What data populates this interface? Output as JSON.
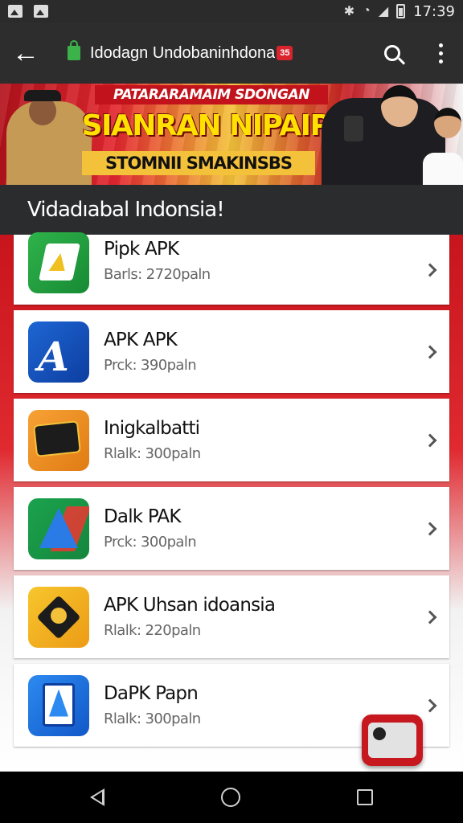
{
  "status_bar": {
    "time": "17:39",
    "left_icons": [
      "image-notification-icon",
      "image-notification-icon"
    ],
    "right_icons": [
      "bluetooth-icon",
      "wifi-icon",
      "signal-icon",
      "battery-icon"
    ]
  },
  "toolbar": {
    "url": "Idodagn Undobaninhdona",
    "badge": "35"
  },
  "banner": {
    "line1": "PATARARAMAIM SDONGAN",
    "line2": "SIANRAN NIPAIP",
    "line3": "STOMNII SMAKINSBS"
  },
  "section": {
    "title": "Vidadıabal Indonsia!"
  },
  "apps": [
    {
      "name": "Pipk APK",
      "meta": "Barls: 2720paln",
      "icon": "green-doc-icon"
    },
    {
      "name": "APK APK",
      "meta": "Prck: 390paln",
      "icon": "blue-book-icon"
    },
    {
      "name": "Inigkalbatti",
      "meta": "Rlalk: 300paln",
      "icon": "orange-sign-icon"
    },
    {
      "name": "Dalk PAK",
      "meta": "Prck: 300paln",
      "icon": "triangle-icon"
    },
    {
      "name": "APK Uhsan idoansia",
      "meta": "Rlalk: 220paln",
      "icon": "yellow-badge-icon"
    },
    {
      "name": "DaPK Papn",
      "meta": "Rlalk: 300paln",
      "icon": "blue-doc-icon"
    }
  ],
  "colors": {
    "accent_red": "#c71820",
    "toolbar": "#2d2d2d",
    "lock_green": "#3cb34a"
  }
}
